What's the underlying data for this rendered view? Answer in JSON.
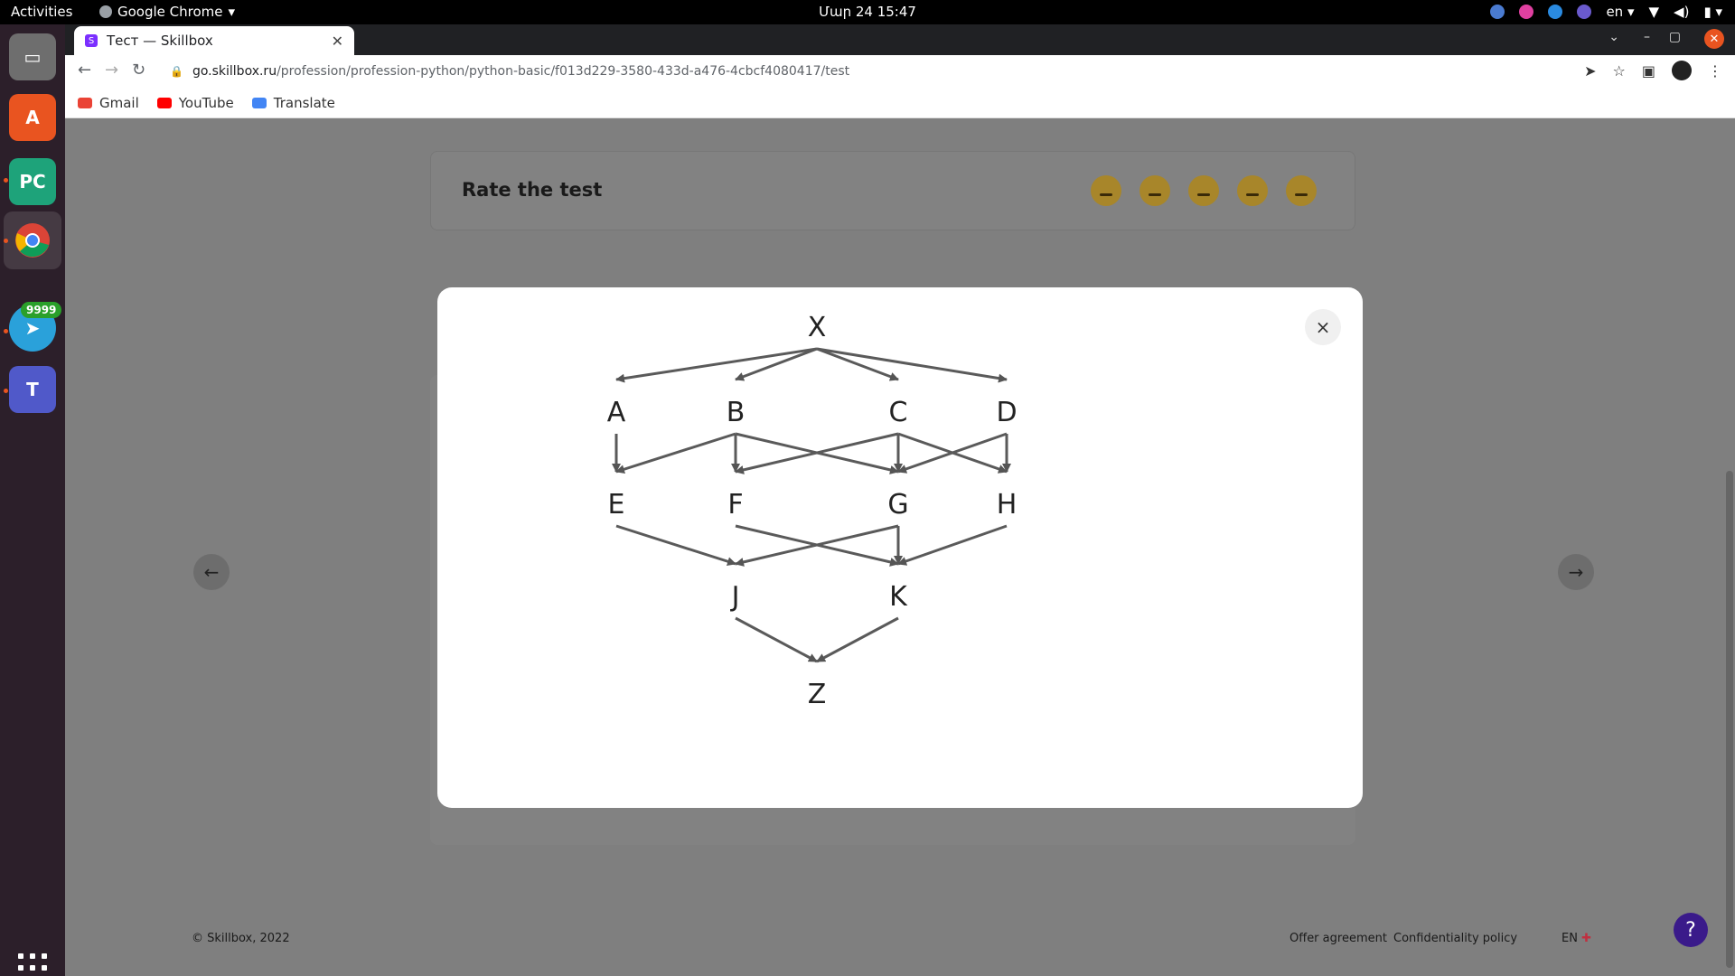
{
  "topbar": {
    "activities": "Activities",
    "app_name": "Google Chrome",
    "clock": "Մար 24  15:47",
    "lang": "en"
  },
  "dock": {
    "items": [
      "files",
      "app-center",
      "pycharm",
      "chrome",
      "telegram",
      "teams"
    ],
    "telegram_badge": "9999"
  },
  "browser": {
    "tab_title": "Тест — Skillbox",
    "tab_favicon": "S",
    "url_host": "go.skillbox.ru",
    "url_path": "/profession/profession-python/python-basic/f013d229-3580-433d-a476-4cbcf4080417/test",
    "bookmarks": [
      "Gmail",
      "YouTube",
      "Translate"
    ]
  },
  "page": {
    "rate_title": "Rate the test",
    "footer_copy": "© Skillbox, 2022",
    "footer_offer": "Offer agreement",
    "footer_privacy": "Confidentiality policy",
    "footer_lang": "EN",
    "help": "?"
  },
  "modal": {
    "close": "×",
    "nodes": [
      {
        "id": "X",
        "label": "X"
      },
      {
        "id": "A",
        "label": "A"
      },
      {
        "id": "B",
        "label": "B"
      },
      {
        "id": "C",
        "label": "C"
      },
      {
        "id": "D",
        "label": "D"
      },
      {
        "id": "E",
        "label": "E"
      },
      {
        "id": "F",
        "label": "F"
      },
      {
        "id": "G",
        "label": "G"
      },
      {
        "id": "H",
        "label": "H"
      },
      {
        "id": "J",
        "label": "J"
      },
      {
        "id": "K",
        "label": "K"
      },
      {
        "id": "Z",
        "label": "Z"
      }
    ],
    "edges": [
      [
        "X",
        "A"
      ],
      [
        "X",
        "B"
      ],
      [
        "X",
        "C"
      ],
      [
        "X",
        "D"
      ],
      [
        "A",
        "E"
      ],
      [
        "B",
        "E"
      ],
      [
        "B",
        "F"
      ],
      [
        "B",
        "G"
      ],
      [
        "C",
        "F"
      ],
      [
        "C",
        "G"
      ],
      [
        "C",
        "H"
      ],
      [
        "D",
        "G"
      ],
      [
        "D",
        "H"
      ],
      [
        "E",
        "J"
      ],
      [
        "F",
        "K"
      ],
      [
        "G",
        "J"
      ],
      [
        "G",
        "K"
      ],
      [
        "H",
        "K"
      ],
      [
        "J",
        "Z"
      ],
      [
        "K",
        "Z"
      ]
    ]
  }
}
